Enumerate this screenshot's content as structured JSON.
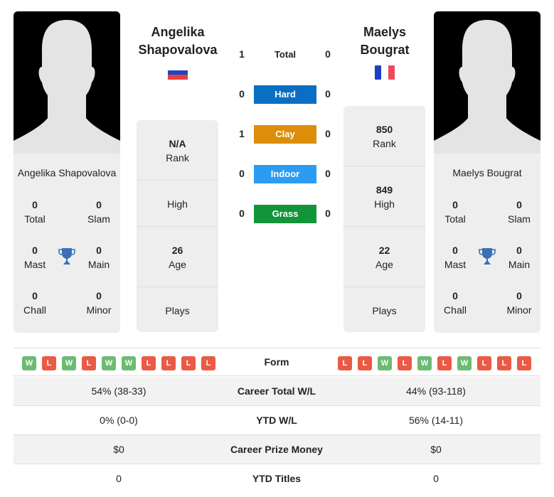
{
  "player1": {
    "name": "Angelika Shapovalova",
    "name_line1": "Angelika",
    "name_line2": "Shapovalova",
    "flag": "russia-flag",
    "titles": {
      "total": {
        "value": "0",
        "label": "Total"
      },
      "slam": {
        "value": "0",
        "label": "Slam"
      },
      "mast": {
        "value": "0",
        "label": "Mast"
      },
      "main": {
        "value": "0",
        "label": "Main"
      },
      "chall": {
        "value": "0",
        "label": "Chall"
      },
      "minor": {
        "value": "0",
        "label": "Minor"
      }
    },
    "stats": {
      "rank": {
        "value": "N/A",
        "label": "Rank"
      },
      "high": {
        "value": "",
        "label": "High"
      },
      "age": {
        "value": "26",
        "label": "Age"
      },
      "plays": {
        "value": "",
        "label": "Plays"
      }
    },
    "form": [
      "W",
      "L",
      "W",
      "L",
      "W",
      "W",
      "L",
      "L",
      "L",
      "L"
    ]
  },
  "player2": {
    "name": "Maelys Bougrat",
    "name_line1": "Maelys",
    "name_line2": "Bougrat",
    "flag": "france-flag",
    "titles": {
      "total": {
        "value": "0",
        "label": "Total"
      },
      "slam": {
        "value": "0",
        "label": "Slam"
      },
      "mast": {
        "value": "0",
        "label": "Mast"
      },
      "main": {
        "value": "0",
        "label": "Main"
      },
      "chall": {
        "value": "0",
        "label": "Chall"
      },
      "minor": {
        "value": "0",
        "label": "Minor"
      }
    },
    "stats": {
      "rank": {
        "value": "850",
        "label": "Rank"
      },
      "high": {
        "value": "849",
        "label": "High"
      },
      "age": {
        "value": "22",
        "label": "Age"
      },
      "plays": {
        "value": "",
        "label": "Plays"
      }
    },
    "form": [
      "L",
      "L",
      "W",
      "L",
      "W",
      "L",
      "W",
      "L",
      "L",
      "L"
    ]
  },
  "h2h": [
    {
      "label": "Total",
      "left": "1",
      "right": "0",
      "color": ""
    },
    {
      "label": "Hard",
      "left": "0",
      "right": "0",
      "color": "#0a6fc2"
    },
    {
      "label": "Clay",
      "left": "1",
      "right": "0",
      "color": "#dc8e0a"
    },
    {
      "label": "Indoor",
      "left": "0",
      "right": "0",
      "color": "#2b9cf2"
    },
    {
      "label": "Grass",
      "left": "0",
      "right": "0",
      "color": "#12943b"
    }
  ],
  "form_label": "Form",
  "comparison": [
    {
      "label": "Career Total W/L",
      "left": "54% (38-33)",
      "right": "44% (93-118)"
    },
    {
      "label": "YTD W/L",
      "left": "0% (0-0)",
      "right": "56% (14-11)"
    },
    {
      "label": "Career Prize Money",
      "left": "$0",
      "right": "$0"
    },
    {
      "label": "YTD Titles",
      "left": "0",
      "right": "0"
    }
  ],
  "colors": {
    "win": "#6dbb72",
    "loss": "#ea5a44",
    "trophy": "#3a6fb8"
  }
}
